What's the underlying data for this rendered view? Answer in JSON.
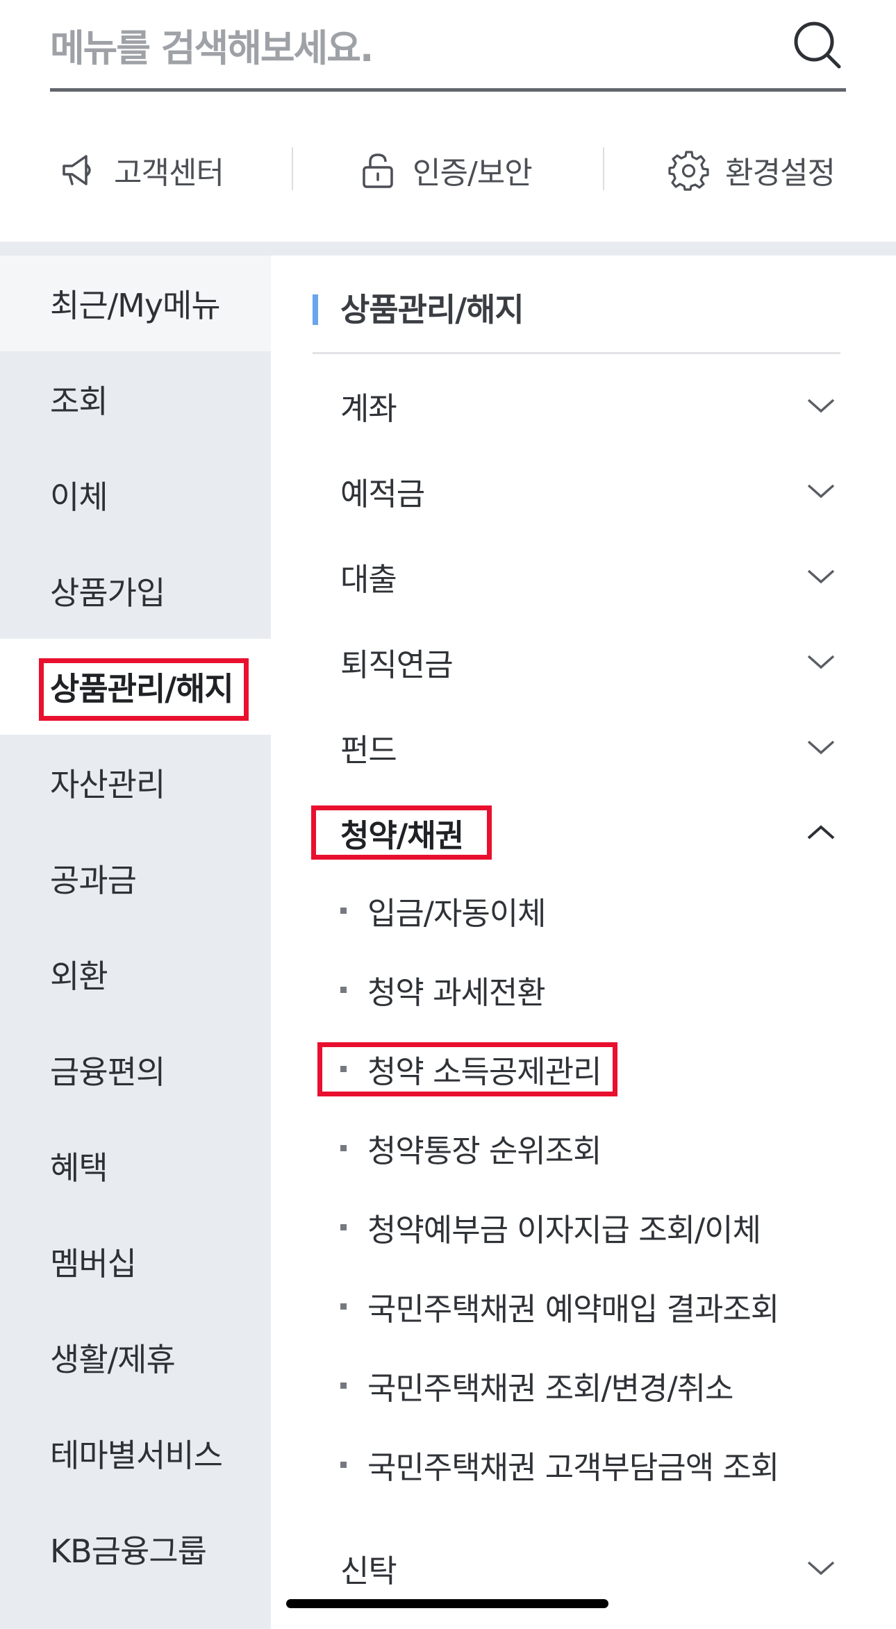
{
  "search": {
    "placeholder": "메뉴를 검색해보세요."
  },
  "quick_links": [
    {
      "label": "고객센터",
      "icon": "megaphone-icon"
    },
    {
      "label": "인증/보안",
      "icon": "lock-icon"
    },
    {
      "label": "환경설정",
      "icon": "gear-icon"
    }
  ],
  "left_nav": [
    "최근/My메뉴",
    "조회",
    "이체",
    "상품가입",
    "상품관리/해지",
    "자산관리",
    "공과금",
    "외환",
    "금융편의",
    "혜택",
    "멤버십",
    "생활/제휴",
    "테마별서비스",
    "KB금융그룹"
  ],
  "left_nav_selected": "상품관리/해지",
  "panel": {
    "title": "상품관리/해지",
    "categories": [
      "계좌",
      "예적금",
      "대출",
      "퇴직연금",
      "펀드",
      "청약/채권",
      "신탁"
    ],
    "expanded": "청약/채권",
    "sub_items": [
      "입금/자동이체",
      "청약 과세전환",
      "청약 소득공제관리",
      "청약통장 순위조회",
      "청약예부금 이자지급 조회/이체",
      "국민주택채권 예약매입 결과조회",
      "국민주택채권 조회/변경/취소",
      "국민주택채권 고객부담금액 조회"
    ]
  },
  "colors": {
    "highlight": "#e8102e",
    "accent_bar": "#6aa4ec",
    "nav_bg": "#e8ecf1"
  }
}
